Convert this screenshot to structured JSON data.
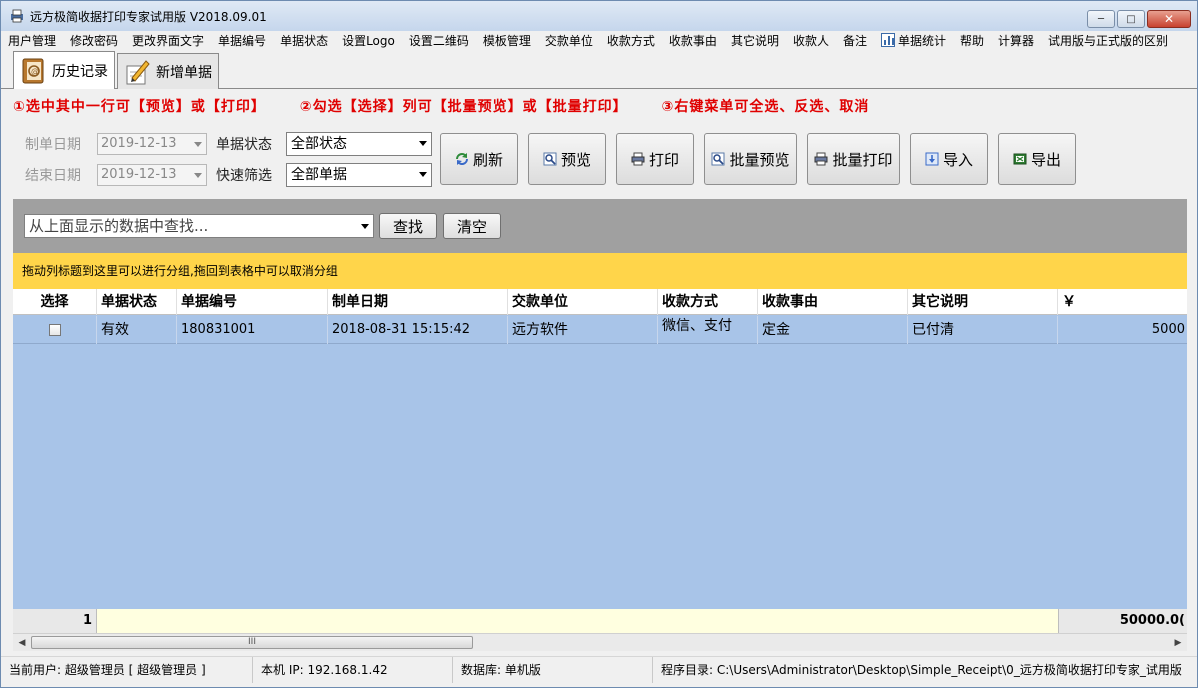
{
  "window": {
    "title": "远方极简收据打印专家试用版 V2018.09.01",
    "min_glyph": "─",
    "max_glyph": "□",
    "close_glyph": "✕"
  },
  "menu": [
    {
      "label": "用户管理"
    },
    {
      "label": "修改密码"
    },
    {
      "label": "更改界面文字"
    },
    {
      "label": "单据编号"
    },
    {
      "label": "单据状态"
    },
    {
      "label": "设置Logo"
    },
    {
      "label": "设置二维码"
    },
    {
      "label": "模板管理"
    },
    {
      "label": "交款单位"
    },
    {
      "label": "收款方式"
    },
    {
      "label": "收款事由"
    },
    {
      "label": "其它说明"
    },
    {
      "label": "收款人"
    },
    {
      "label": "备注"
    },
    {
      "label": "单据统计",
      "icon": "bar-chart-icon"
    },
    {
      "label": "帮助"
    },
    {
      "label": "计算器"
    },
    {
      "label": "试用版与正式版的区别"
    }
  ],
  "tabs": [
    {
      "label": "历史记录",
      "icon": "address-book-icon",
      "active": true
    },
    {
      "label": "新增单据",
      "icon": "pencil-notepad-icon",
      "active": false
    }
  ],
  "hints": [
    "①选中其中一行可【预览】或【打印】",
    "②勾选【选择】列可【批量预览】或【批量打印】",
    "③右键菜单可全选、反选、取消"
  ],
  "filters": {
    "start_date_label": "制单日期",
    "start_date_value": "2019-12-13",
    "end_date_label": "结束日期",
    "end_date_value": "2019-12-13",
    "status_label": "单据状态",
    "status_value": "全部状态",
    "quick_label": "快速筛选",
    "quick_value": "全部单据"
  },
  "toolbar": {
    "refresh": "刷新",
    "preview": "预览",
    "print": "打印",
    "batch_preview": "批量预览",
    "batch_print": "批量打印",
    "import": "导入",
    "export": "导出"
  },
  "search": {
    "placeholder": "从上面显示的数据中查找...",
    "find_label": "查找",
    "clear_label": "清空"
  },
  "group_hint": "拖动列标题到这里可以进行分组,拖回到表格中可以取消分组",
  "table": {
    "columns": [
      "选择",
      "单据状态",
      "单据编号",
      "制单日期",
      "交款单位",
      "收款方式",
      "收款事由",
      "其它说明",
      "￥"
    ],
    "rows": [
      {
        "checked": false,
        "status": "有效",
        "number": "180831001",
        "date": "2018-08-31 15:15:42",
        "payer": "远方软件",
        "method": "微信、支付",
        "reason": "定金",
        "other": "已付清",
        "amount": "5000"
      }
    ],
    "footer_count": "1",
    "footer_total": "50000.0("
  },
  "scrollbar": {
    "thumb_grip": "III",
    "left_arrow": "◀",
    "right_arrow": "▶"
  },
  "statusbar": {
    "user": "当前用户: 超级管理员 [ 超级管理员 ]",
    "ip": "本机 IP: 192.168.1.42",
    "db": "数据库: 单机版",
    "dir": "程序目录: C:\\Users\\Administrator\\Desktop\\Simple_Receipt\\0_远方极简收据打印专家_试用版"
  },
  "colors": {
    "hint_red": "#e00000",
    "group_bar": "#ffd54a",
    "grid_bg": "#a8c4e8",
    "search_bar": "#a0a0a0"
  }
}
